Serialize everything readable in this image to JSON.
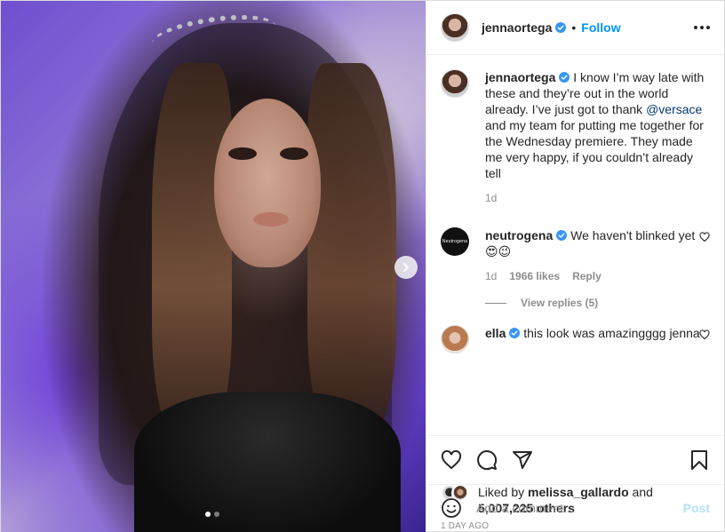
{
  "post": {
    "carousel": {
      "slide_count": 2,
      "active_index": 0,
      "next_icon": "chevron-right-icon"
    },
    "author": {
      "username": "jennaortega",
      "verified": true
    },
    "header": {
      "separator": "•",
      "follow_label": "Follow",
      "more_icon": "more-horizontal-icon"
    },
    "caption": {
      "username": "jennaortega",
      "text_before": " I know I’m way late with these and they’re out in the world already. I’ve just got to thank ",
      "mention": "@versace",
      "text_after": " and my team for putting me together for the Wednesday premiere. They made me very happy, if you couldn’t already tell",
      "time": "1d"
    },
    "comments": [
      {
        "username": "neutrogena",
        "avatar_text": "Neutrogena",
        "verified": true,
        "text": " We haven't blinked yet 😍😉",
        "time": "1d",
        "likes": "1966 likes",
        "reply_label": "Reply",
        "view_replies": "View replies (5)"
      },
      {
        "username": "ella",
        "verified": true,
        "text": " this look was amazingggg jenna"
      }
    ],
    "actions": {
      "like_icon": "heart-icon",
      "comment_icon": "comment-icon",
      "share_icon": "send-icon",
      "save_icon": "bookmark-icon"
    },
    "likes": {
      "prefix": "Liked by ",
      "liked_by": "melissa_gallardo",
      "and": " and",
      "others": "5,007,225 others"
    },
    "posted_ago": "1 DAY AGO",
    "add_comment": {
      "placeholder": "Add a comment...",
      "post_label": "Post",
      "emoji_icon": "smiley-icon"
    }
  },
  "colors": {
    "link": "#0095f6",
    "verified": "#3897f0",
    "muted": "#8e8e8e",
    "post_disabled": "#b2dffc"
  }
}
